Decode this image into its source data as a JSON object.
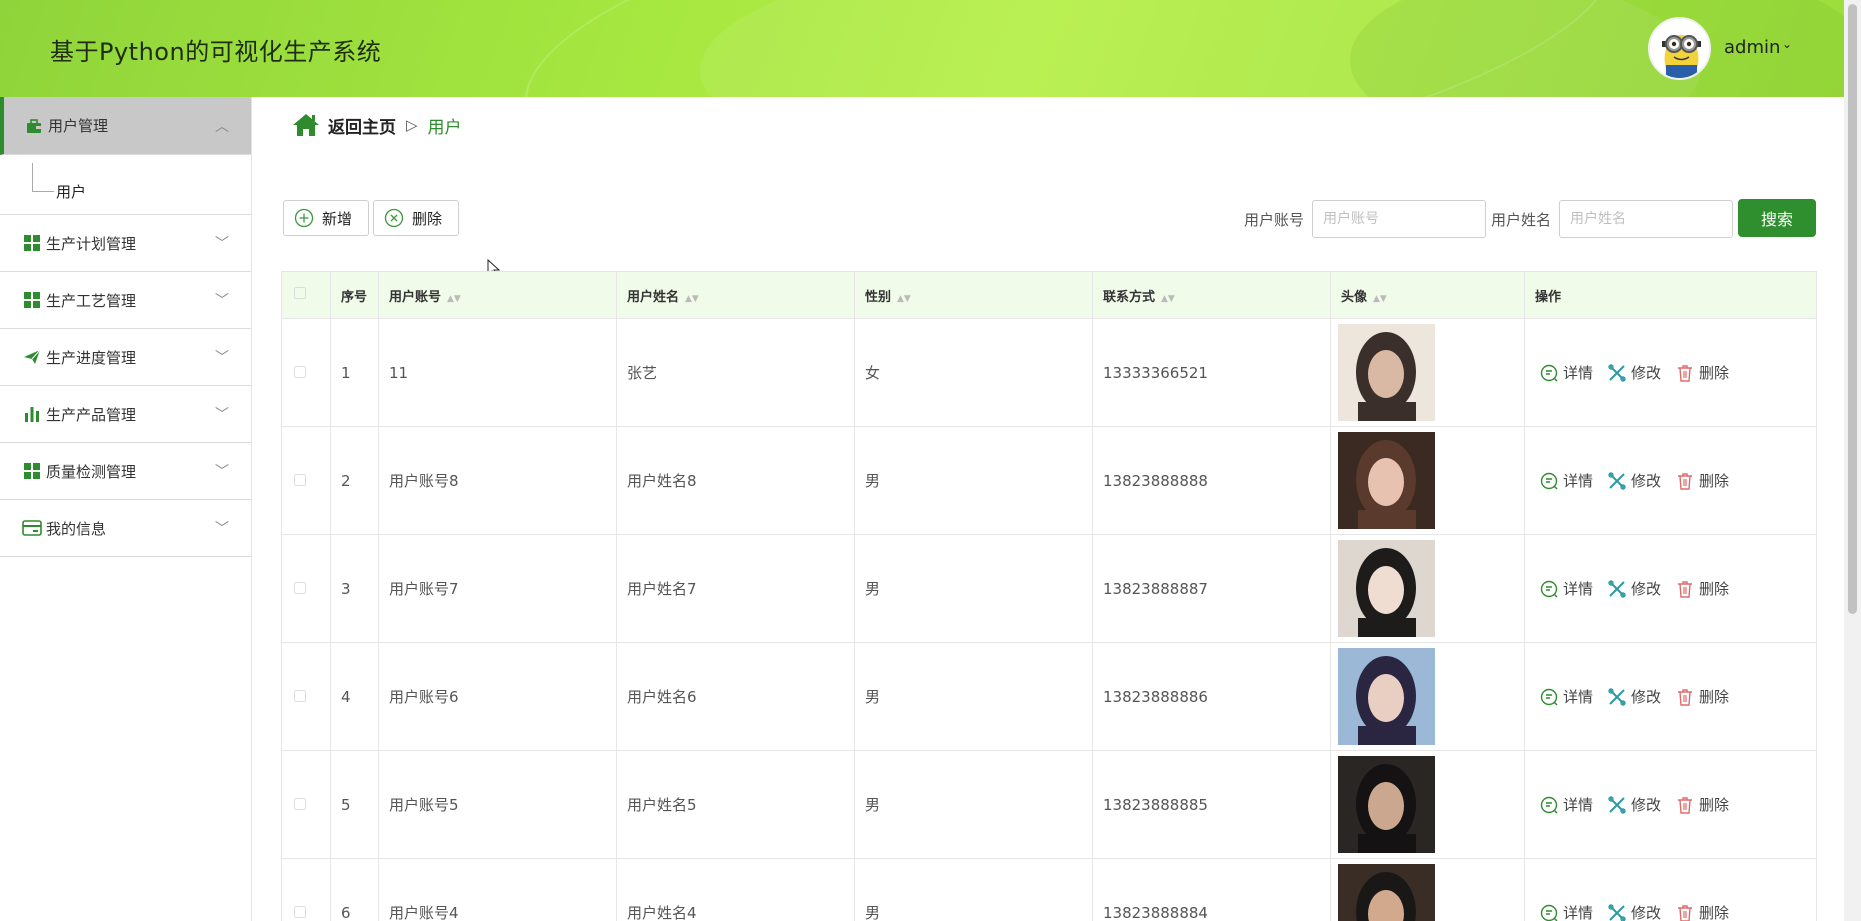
{
  "app": {
    "title": "基于Python的可视化生产系统",
    "user": "admin"
  },
  "sidebar": {
    "groups": [
      {
        "label": "用户管理",
        "icon": "briefcase-icon",
        "expanded": true,
        "children": [
          "用户"
        ]
      },
      {
        "label": "生产计划管理",
        "icon": "grid-icon"
      },
      {
        "label": "生产工艺管理",
        "icon": "grid-icon"
      },
      {
        "label": "生产进度管理",
        "icon": "paper-plane-icon"
      },
      {
        "label": "生产产品管理",
        "icon": "bar-chart-icon"
      },
      {
        "label": "质量检测管理",
        "icon": "grid-icon"
      },
      {
        "label": "我的信息",
        "icon": "card-icon"
      }
    ]
  },
  "breadcrumb": {
    "home": "返回主页",
    "sep": "▷",
    "current": "用户"
  },
  "toolbar": {
    "add_label": "新增",
    "delete_label": "删除"
  },
  "search": {
    "account_label": "用户账号",
    "account_placeholder": "用户账号",
    "name_label": "用户姓名",
    "name_placeholder": "用户姓名",
    "button": "搜索"
  },
  "table": {
    "headers": [
      "序号",
      "用户账号",
      "用户姓名",
      "性别",
      "联系方式",
      "头像",
      "操作"
    ],
    "ops": [
      "详情",
      "修改",
      "删除"
    ],
    "rows": [
      {
        "idx": "1",
        "account": "11",
        "name": "张艺",
        "gender": "女",
        "phone": "13333366521"
      },
      {
        "idx": "2",
        "account": "用户账号8",
        "name": "用户姓名8",
        "gender": "男",
        "phone": "13823888888"
      },
      {
        "idx": "3",
        "account": "用户账号7",
        "name": "用户姓名7",
        "gender": "男",
        "phone": "13823888887"
      },
      {
        "idx": "4",
        "account": "用户账号6",
        "name": "用户姓名6",
        "gender": "男",
        "phone": "13823888886"
      },
      {
        "idx": "5",
        "account": "用户账号5",
        "name": "用户姓名5",
        "gender": "男",
        "phone": "13823888885"
      },
      {
        "idx": "6",
        "account": "用户账号4",
        "name": "用户姓名4",
        "gender": "男",
        "phone": "13823888884"
      }
    ]
  },
  "colors": {
    "brand": "#2f8f2f",
    "header_bg": "#a3e53f",
    "table_head_bg": "#f1fbe9"
  }
}
